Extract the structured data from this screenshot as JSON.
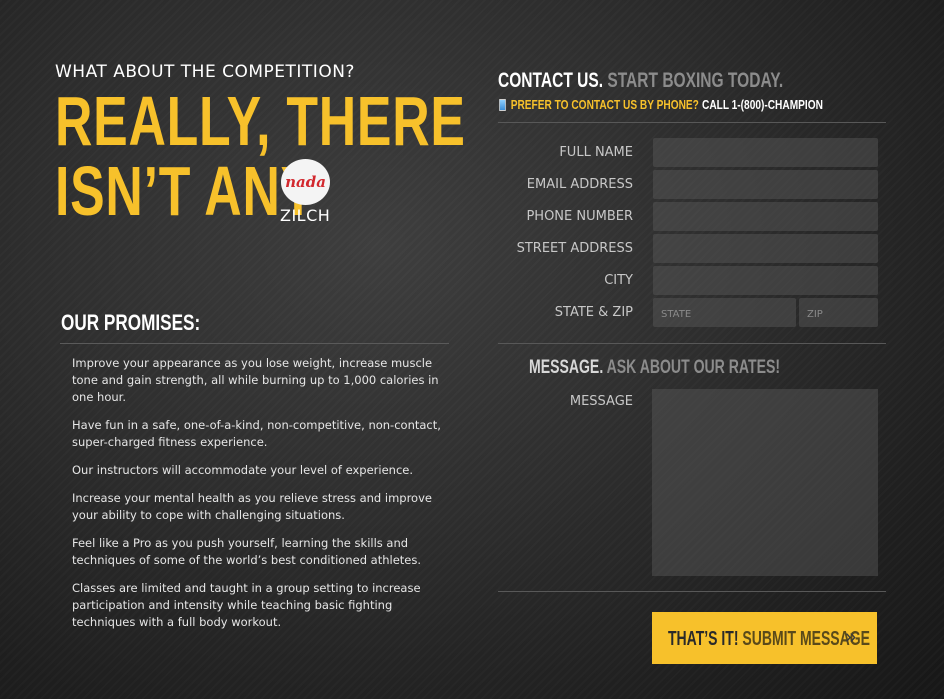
{
  "left": {
    "kicker": "WHAT ABOUT THE COMPETITION?",
    "headline_line1": "REALLY, THERE",
    "headline_line2": "ISN’T ANY",
    "badge_text": "nada",
    "badge_caption": "ZILCH",
    "promises_title": "OUR PROMISES:",
    "promises": [
      "Improve your appearance as you lose weight, increase muscle tone and gain strength, all while burning up to 1,000 calories in one hour.",
      "Have fun in a safe, one-of-a-kind, non-competitive, non-contact, super-charged fitness experience.",
      "Our instructors will accommodate your level of experience.",
      "Increase your mental health as you relieve stress and improve your ability to cope with challenging situations.",
      "Feel like a Pro as you push yourself, learning the skills and techniques of some of the world’s best conditioned athletes.",
      "Classes are limited and taught in a group setting to increase participation and intensity while teaching basic fighting techniques with a full body workout."
    ]
  },
  "contact": {
    "heading_strong": "CONTACT US.",
    "heading_sub": "START BOXING TODAY.",
    "phone_prompt": "PREFER TO CONTACT US BY PHONE?",
    "phone_call": "CALL 1-(800)-CHAMPION",
    "fields": {
      "full_name": {
        "label": "FULL NAME",
        "value": ""
      },
      "email": {
        "label": "EMAIL ADDRESS",
        "value": ""
      },
      "phone": {
        "label": "PHONE NUMBER",
        "value": ""
      },
      "street": {
        "label": "STREET ADDRESS",
        "value": ""
      },
      "city": {
        "label": "CITY",
        "value": ""
      },
      "state_zip": {
        "label": "STATE & ZIP",
        "state_placeholder": "STATE",
        "zip_placeholder": "ZIP"
      }
    },
    "message_heading_strong": "MESSAGE.",
    "message_heading_sub": "ASK ABOUT OUR RATES!",
    "message_label": "MESSAGE",
    "submit_strong": "THAT’S IT!",
    "submit_sub": "SUBMIT MESSAGE",
    "submit_arrow": "»"
  },
  "colors": {
    "accent": "#f7c12b",
    "badge_red": "#d2282e",
    "background": "#2d2d2d"
  }
}
